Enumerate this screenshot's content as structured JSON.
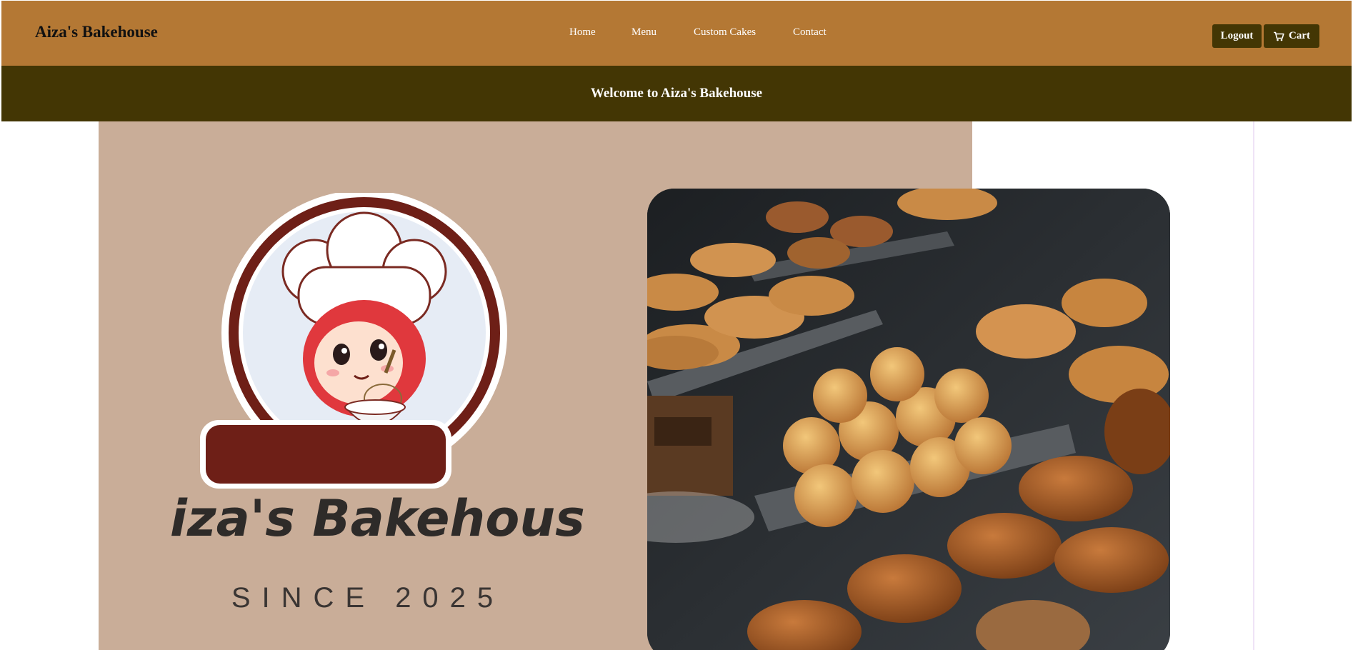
{
  "header": {
    "brand": "Aiza's Bakehouse",
    "nav": [
      "Home",
      "Menu",
      "Custom Cakes",
      "Contact"
    ],
    "logout_label": "Logout",
    "cart_label": "Cart"
  },
  "banner": {
    "welcome_text": "Welcome to Aiza's Bakehouse"
  },
  "hero": {
    "logo_title": "Aiza's Bakehouse",
    "logo_since": "SINCE 2025"
  },
  "colors": {
    "header": "#b47834",
    "banner": "#433604",
    "hero_background": "#c9ad98",
    "logo_ring": "#6e1f17"
  }
}
